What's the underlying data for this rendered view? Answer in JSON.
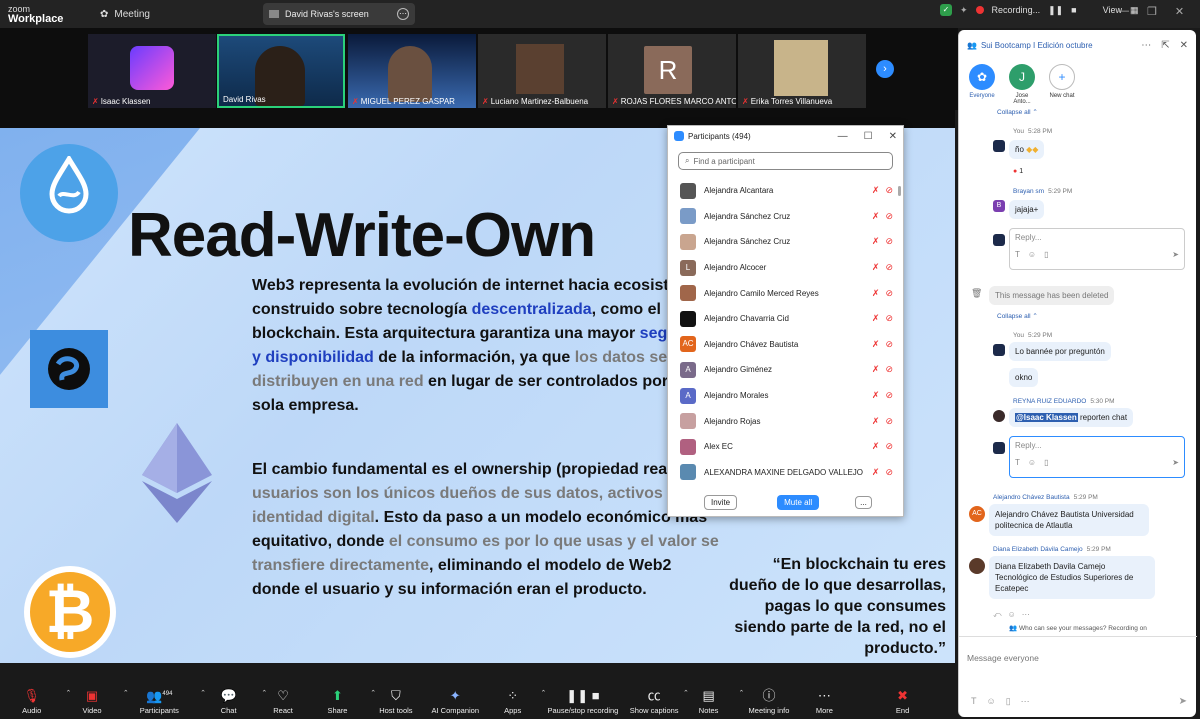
{
  "app": {
    "logo_line1": "zoom",
    "logo_line2": "Workplace",
    "meeting_label": "Meeting"
  },
  "tab": {
    "title": "David Rivas's screen"
  },
  "recording": {
    "label": "Recording...",
    "view_label": "View"
  },
  "participants_strip": [
    {
      "name": "Isaac Klassen",
      "muted": true
    },
    {
      "name": "David Rivas",
      "muted": false,
      "active": true
    },
    {
      "name": "MIGUEL PEREZ GASPAR",
      "muted": true
    },
    {
      "name": "Luciano Martinez-Balbuena",
      "muted": true
    },
    {
      "name": "ROJAS FLORES MARCO ANTO...",
      "muted": true,
      "initial": "R"
    },
    {
      "name": "Erika Torres Villanueva",
      "muted": true
    }
  ],
  "slide": {
    "title": "Read-Write-Own",
    "p1_a": "Web3 representa la evolución de internet hacia ecosistema construido sobre tecnología ",
    "p1_b": "descentralizada",
    "p1_c": ", como el blockchain. Esta arquitectura garantiza una mayor ",
    "p1_d": "seguridad y disponibilidad",
    "p1_e": " de la información, ya que ",
    "p1_f": "los datos se distribuyen en una red",
    "p1_g": " en lugar de ser controlados por una sola empresa.",
    "p2_a": "El cambio fundamental es el ownership (propiedad real): ",
    "p2_b": "los usuarios son los únicos dueños de sus datos, activos e identidad digital",
    "p2_c": ". Esto da paso a un modelo económico más equitativo, donde ",
    "p2_d": "el consumo es por lo que usas y el valor se transfiere directamente",
    "p2_e": ", eliminando el modelo de Web2 donde el usuario y su información eran el producto.",
    "quote": "“En blockchain tu eres dueño de lo que desarrollas, pagas lo que consumes siendo parte de la red, no el producto.”"
  },
  "participants_panel": {
    "title": "Participants (494)",
    "search_placeholder": "Find a participant",
    "rows": [
      {
        "name": "Alejandra Alcantara",
        "avatar_color": "#555555",
        "initial": ""
      },
      {
        "name": "Alejandra Sánchez Cruz",
        "avatar_color": "#7a9bc7",
        "initial": ""
      },
      {
        "name": "Alejandra Sánchez Cruz",
        "avatar_color": "#c9a58f",
        "initial": ""
      },
      {
        "name": "Alejandro Alcocer",
        "avatar_color": "#8a6a5a",
        "initial": "L"
      },
      {
        "name": "Alejandro Camilo Merced Reyes",
        "avatar_color": "#a0664a",
        "initial": ""
      },
      {
        "name": "Alejandro Chavarria Cid",
        "avatar_color": "#111111",
        "initial": ""
      },
      {
        "name": "Alejandro Chávez Bautista",
        "avatar_color": "#e2651c",
        "initial": "AC"
      },
      {
        "name": "Alejandro Giménez",
        "avatar_color": "#7a6a8a",
        "initial": "A"
      },
      {
        "name": "Alejandro Morales",
        "avatar_color": "#5a6ac7",
        "initial": "A"
      },
      {
        "name": "Alejandro Rojas",
        "avatar_color": "#c7a0a0",
        "initial": ""
      },
      {
        "name": "Alex EC",
        "avatar_color": "#b06080",
        "initial": ""
      },
      {
        "name": "ALEXANDRA MAXINE DELGADO VALLEJO",
        "avatar_color": "#5a8ab0",
        "initial": ""
      }
    ],
    "invite_label": "Invite",
    "mute_all_label": "Mute all",
    "more_label": "..."
  },
  "chat": {
    "title": "Sui Bootcamp I Edición octubre",
    "tabs": [
      {
        "label": "Everyone",
        "initial": "✿",
        "color": "#2d8cff"
      },
      {
        "label": "Jose Anto...",
        "initial": "J",
        "color": "#2e9e6b"
      },
      {
        "label": "New chat",
        "initial": "+",
        "color": "#ffffff"
      }
    ],
    "collapse_all": "Collapse all",
    "you_label": "You",
    "time_528": "5:28 PM",
    "msg_no": "ño",
    "reaction_count": "1",
    "brayan_name": "Brayan sm",
    "brayan_time": "5:29 PM",
    "brayan_msg": "jajaja+",
    "reply_placeholder": "Reply...",
    "deleted_msg": "This message has been deleted",
    "time_529": "5:29 PM",
    "msg_banned": "Lo bannée por preguntón",
    "msg_okno": "okno",
    "reyna_name": "REYNA RUIZ EDUARDO",
    "reyna_time": "5:30 PM",
    "reyna_mention": "@Isaac Klassen",
    "reyna_msg": " reporten chat",
    "alej_name": "Alejandro Chávez Bautista",
    "alej_time": "5:29 PM",
    "alej_msg": "Alejandro Chávez Bautista Universidad politecnica de Atlautla",
    "diana_name": "Diana Elizabeth Dávila Camejo",
    "diana_time": "5:29 PM",
    "diana_msg": "Diana Elizabeth Davila Camejo Tecnológico de Estudios Superiores de Ecatepec",
    "who_can_see": "Who can see your messages? Recording on",
    "input_placeholder": "Message everyone"
  },
  "toolbar": {
    "audio": "Audio",
    "video": "Video",
    "participants": "Participants",
    "participants_count": "494",
    "chat": "Chat",
    "react": "React",
    "share": "Share",
    "host_tools": "Host tools",
    "ai_companion": "AI Companion",
    "apps": "Apps",
    "pause_recording": "Pause/stop recording",
    "show_captions": "Show captions",
    "notes": "Notes",
    "meeting_info": "Meeting info",
    "more": "More",
    "end": "End"
  },
  "colors": {
    "accent": "#2d8cff",
    "mute_red": "#e33333",
    "active_border": "#2bd17a"
  }
}
